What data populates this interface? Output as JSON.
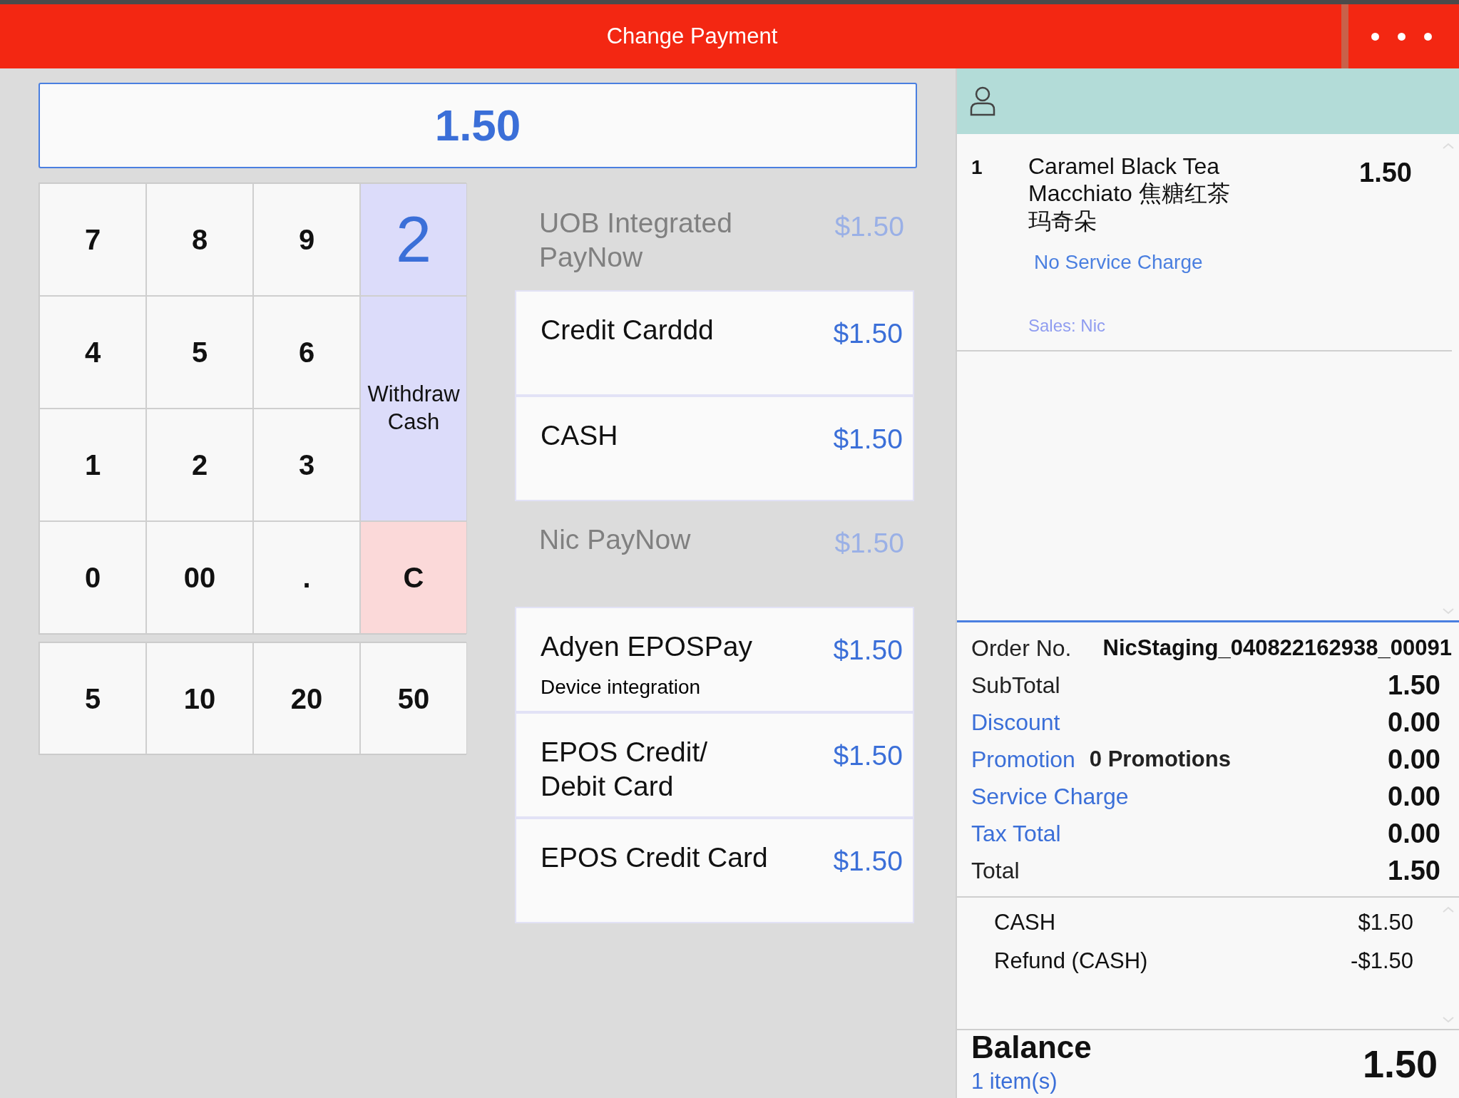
{
  "window": {
    "title": "Change Payment",
    "menu": "• • •"
  },
  "amount": {
    "value": "1.50"
  },
  "keypad": [
    {
      "label": "7",
      "kind": "digit"
    },
    {
      "label": "8",
      "kind": "digit"
    },
    {
      "label": "9",
      "kind": "digit"
    },
    {
      "label": "2",
      "kind": "mode"
    },
    {
      "label": "4",
      "kind": "digit"
    },
    {
      "label": "5",
      "kind": "digit"
    },
    {
      "label": "6",
      "kind": "digit"
    },
    {
      "label": "Withdraw Cash",
      "kind": "withdraw"
    },
    {
      "label": "1",
      "kind": "digit"
    },
    {
      "label": "2",
      "kind": "digit"
    },
    {
      "label": "3",
      "kind": "digit"
    },
    {
      "label": "0",
      "kind": "digit"
    },
    {
      "label": "00",
      "kind": "digit"
    },
    {
      "label": ".",
      "kind": "digit"
    },
    {
      "label": "C",
      "kind": "clear"
    }
  ],
  "quick_amounts": [
    "5",
    "10",
    "20",
    "50"
  ],
  "payment_methods": [
    {
      "name": "UOB Integrated PayNow",
      "amount": "$1.50",
      "enabled": false
    },
    {
      "name": "Credit Carddd",
      "amount": "$1.50",
      "enabled": true
    },
    {
      "name": "CASH",
      "amount": "$1.50",
      "enabled": true
    },
    {
      "name": "Nic PayNow",
      "amount": "$1.50",
      "enabled": false
    },
    {
      "name": "Adyen EPOSPay",
      "subtitle": "Device integration",
      "amount": "$1.50",
      "enabled": true
    },
    {
      "name": "EPOS Credit/ Debit Card",
      "amount": "$1.50",
      "enabled": true
    },
    {
      "name": "EPOS Credit Card",
      "amount": "$1.50",
      "enabled": true
    }
  ],
  "order_items": [
    {
      "qty": "1",
      "name": "Caramel Black Tea Macchiato 焦糖红茶玛奇朵",
      "price": "1.50",
      "note": "No Service Charge",
      "sales": "Sales: Nic"
    }
  ],
  "summary": [
    {
      "label": "Order No.",
      "value": "NicStaging_040822162938_00091",
      "kind": "order"
    },
    {
      "label": "SubTotal",
      "value": "1.50",
      "kind": "plain"
    },
    {
      "label": "Discount",
      "value": "0.00",
      "kind": "link"
    },
    {
      "label": "Promotion",
      "extra": "0 Promotions",
      "value": "0.00",
      "kind": "link"
    },
    {
      "label": "Service Charge",
      "value": "0.00",
      "kind": "link"
    },
    {
      "label": "Tax Total",
      "value": "0.00",
      "kind": "link"
    },
    {
      "label": "Total",
      "value": "1.50",
      "kind": "plain"
    }
  ],
  "payments": [
    {
      "name": "CASH",
      "amount": "$1.50"
    },
    {
      "name": "Refund (CASH)",
      "amount": "-$1.50"
    }
  ],
  "balance": {
    "label": "Balance",
    "items": "1 item(s)",
    "value": "1.50"
  }
}
